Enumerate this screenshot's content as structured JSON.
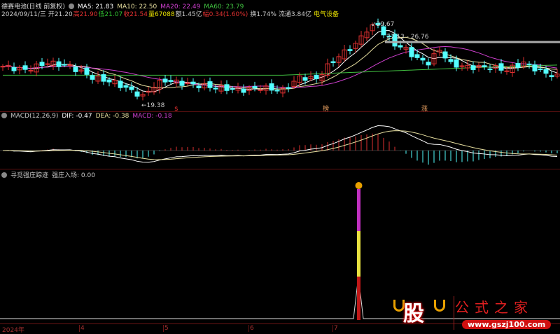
{
  "header": {
    "stock_name": "德赛电池(日线 前复权)",
    "ma5": "MA5: 21.83",
    "ma10": "MA10: 22.50",
    "ma20": "MA20: 22.49",
    "ma60": "MA60: 23.79",
    "date": "2024/09/11/三",
    "open": "开21.20",
    "high": "高21.90",
    "low": "低21.07",
    "close": "收21.54",
    "volume": "量67088",
    "amount": "额1.45亿",
    "change": "幅0.34(1.60%)",
    "turnover": "换1.74%",
    "float_cap": "流通3.84亿",
    "sector": "电气设备"
  },
  "main_chart": {
    "high_label": "29.67",
    "low_label": "19.38",
    "range_label": "27.13 - 26.76",
    "markers": [
      "$",
      "榜",
      "涨"
    ],
    "keypoints": [
      [
        0,
        23.5
      ],
      [
        4,
        23.0
      ],
      [
        8,
        24.0
      ],
      [
        12,
        23.5
      ],
      [
        16,
        22.0
      ],
      [
        20,
        21.3
      ],
      [
        25,
        19.4
      ],
      [
        27,
        20.9
      ],
      [
        29,
        21.6
      ],
      [
        33,
        21.1
      ],
      [
        38,
        20.6
      ],
      [
        43,
        20.3
      ],
      [
        46,
        20.6
      ],
      [
        50,
        20.2
      ],
      [
        53,
        22.0
      ],
      [
        56,
        21.8
      ],
      [
        58,
        23.5
      ],
      [
        60,
        24.9
      ],
      [
        63,
        26.5
      ],
      [
        65,
        28.5
      ],
      [
        67,
        29.2
      ],
      [
        68,
        28.0
      ],
      [
        70,
        26.5
      ],
      [
        72,
        25.8
      ],
      [
        74,
        24.5
      ],
      [
        76,
        24.0
      ],
      [
        78,
        25.8
      ],
      [
        80,
        23.8
      ],
      [
        83,
        23.4
      ],
      [
        87,
        23.4
      ],
      [
        90,
        23.0
      ],
      [
        93,
        24.0
      ],
      [
        96,
        22.8
      ],
      [
        99,
        22.1
      ]
    ],
    "colors": {
      "up": "#e03030",
      "down": "#54ffff",
      "ma5": "#ffffff",
      "ma10": "#e8e0a0",
      "ma20": "#d040d0",
      "ma60": "#40c040"
    }
  },
  "macd": {
    "title": "MACD(12,26,9)",
    "dif": "DIF: -0.47",
    "dea": "DEA: -0.38",
    "macd": "MACD: -0.18"
  },
  "indicator": {
    "title": "寻觅强庄踪迹",
    "label": "强庄入场: 0.00"
  },
  "axis": {
    "labels": [
      "2024年",
      "4",
      "5",
      "6",
      "7"
    ]
  },
  "watermark": {
    "char": "股",
    "name": "公式之家",
    "url": "www.gszj100.com"
  }
}
